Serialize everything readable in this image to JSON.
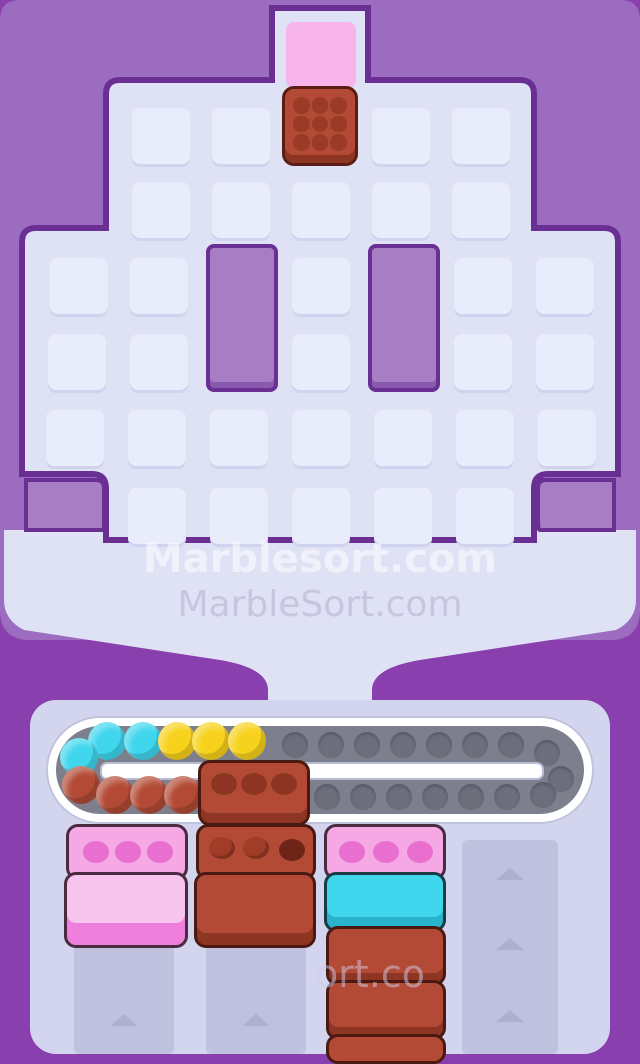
{
  "game": {
    "watermark_primary": "Marblesort.com",
    "watermark_secondary": "MarbleSort.com",
    "watermark_bottom": "ort.co"
  },
  "colors": {
    "background": "#8a3fae",
    "board": "#e9ecfb",
    "pink": "#f5a8e4",
    "brown": "#b24a35",
    "cyan": "#3fd6ee",
    "yellow": "#f7d21c",
    "gray_track": "#7d7f8c"
  },
  "board": {
    "spawn_box_color": "brown",
    "grid_rows": 6,
    "grid_cols": 7
  },
  "conveyor": {
    "marbles_top_row": [
      "cyan",
      "cyan",
      "cyan",
      "yellow",
      "yellow",
      "yellow"
    ],
    "marbles_bottom_row": [
      "cyan",
      "brown",
      "brown",
      "brown",
      "brown"
    ],
    "empty_slot_count": 20
  },
  "columns": [
    {
      "name": "column-1",
      "boxes": [
        "pink",
        "pink"
      ],
      "top_holes_filled": 0
    },
    {
      "name": "column-2",
      "boxes": [
        "brown",
        "brown",
        "brown"
      ],
      "top_holes_filled": 3
    },
    {
      "name": "column-3",
      "boxes": [
        "pink",
        "cyan",
        "brown",
        "brown",
        "brown"
      ],
      "top_holes_filled": 0
    },
    {
      "name": "column-4",
      "boxes": [],
      "top_holes_filled": 0
    }
  ]
}
